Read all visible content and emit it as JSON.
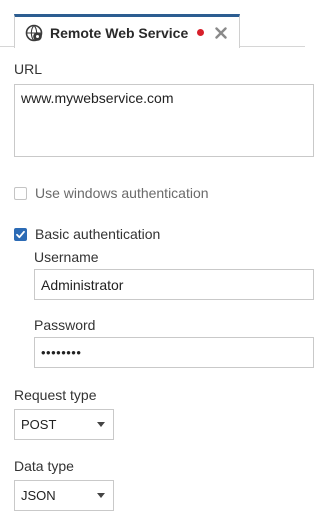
{
  "tab": {
    "title": "Remote Web Service",
    "icon": "web-service-gear-icon",
    "dirty_color": "#d71f2a",
    "close_icon": "close-icon"
  },
  "form": {
    "url_label": "URL",
    "url_value": "www.mywebservice.com",
    "windows_auth_label": "Use windows authentication",
    "windows_auth_checked": false,
    "basic_auth_label": "Basic authentication",
    "basic_auth_checked": true,
    "username_label": "Username",
    "username_value": "Administrator",
    "password_label": "Password",
    "password_value": "••••••••",
    "request_type_label": "Request type",
    "request_type_value": "POST",
    "data_type_label": "Data type",
    "data_type_value": "JSON"
  },
  "colors": {
    "accent": "#2c5d91",
    "checkbox_checked": "#2c6bb5"
  }
}
